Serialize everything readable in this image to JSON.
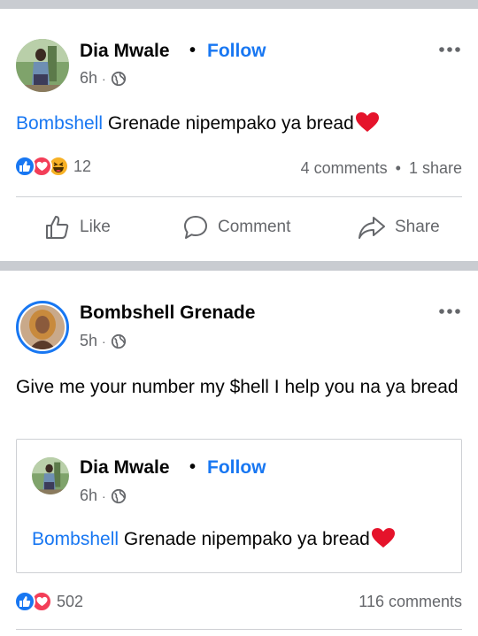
{
  "post1": {
    "author": "Dia Mwale",
    "follow_label": "Follow",
    "separator": "•",
    "time": "6h",
    "time_sep": "·",
    "mention": "Bombshell",
    "text_rest": " Grenade nipempako ya bread",
    "reaction_count": "12",
    "comments": "4 comments",
    "stats_sep": "•",
    "shares": "1 share",
    "actions": {
      "like": "Like",
      "comment": "Comment",
      "share": "Share"
    }
  },
  "post2": {
    "author": "Bombshell Grenade",
    "time": "5h",
    "time_sep": "·",
    "text": "Give me your number my $hell I help you na ya bread",
    "shared": {
      "author": "Dia Mwale",
      "follow_label": "Follow",
      "separator": "•",
      "time": "6h",
      "time_sep": "·",
      "mention": "Bombshell",
      "text_rest": " Grenade nipempako ya bread"
    },
    "reaction_count": "502",
    "comments": "116 comments"
  },
  "colors": {
    "link": "#1877f2",
    "secondary_text": "#65676b",
    "like_blue": "#1877f2",
    "love_red": "#f33e58",
    "haha_yellow": "#f7b125",
    "divider": "#c9ccd1"
  },
  "icons": [
    "globe-icon",
    "more-icon",
    "like-icon",
    "comment-icon",
    "share-icon",
    "heart-emoji-icon",
    "like-reaction-icon",
    "love-reaction-icon",
    "haha-reaction-icon"
  ]
}
